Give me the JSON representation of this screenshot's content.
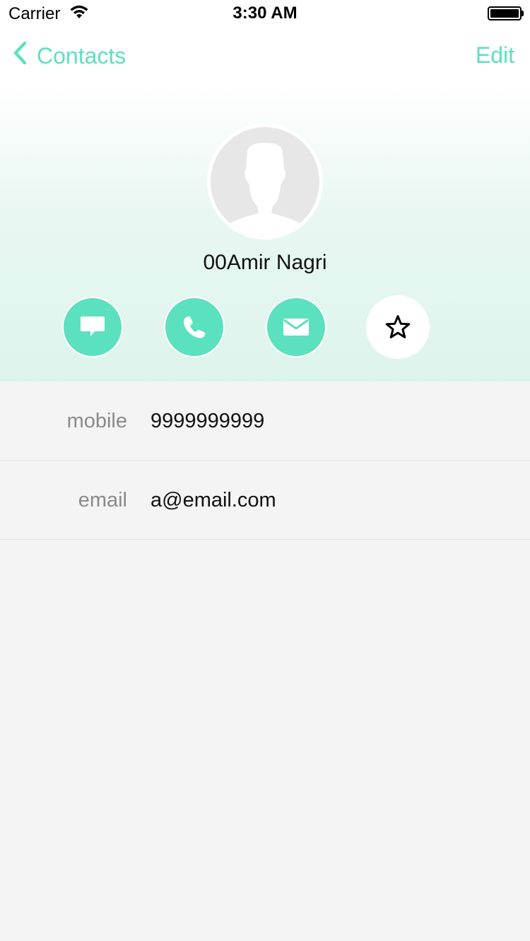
{
  "status_bar": {
    "carrier": "Carrier",
    "time": "3:30 AM",
    "battery_level": 1.0
  },
  "nav": {
    "back_label": "Contacts",
    "edit_label": "Edit"
  },
  "contact": {
    "name": "00Amir Nagri"
  },
  "actions": [
    {
      "icon": "message-icon"
    },
    {
      "icon": "phone-icon"
    },
    {
      "icon": "mail-icon"
    },
    {
      "icon": "star-icon"
    }
  ],
  "details": [
    {
      "label": "mobile",
      "value": "9999999999"
    },
    {
      "label": "email",
      "value": "a@email.com"
    }
  ],
  "colors": {
    "accent": "#5ce1bf",
    "background": "#f4f4f4",
    "header_tint": "#ddf4ec"
  }
}
